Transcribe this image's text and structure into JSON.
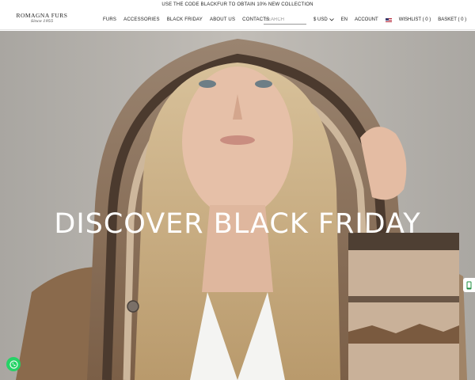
{
  "announcement": "USE THE CODE BLACKFUR TO OBTAIN 10% NEW COLLECTION",
  "logo": {
    "brand": "ROMAGNA FURS",
    "since": "Since 1955"
  },
  "nav": [
    "FURS",
    "ACCESSORIES",
    "BLACK FRIDAY",
    "ABOUT US",
    "CONTACTS"
  ],
  "search": {
    "placeholder": "SEARCH",
    "value": ""
  },
  "currency": "$ USD",
  "language": "EN",
  "account": "ACCOUNT",
  "wishlist": "WISHLIST ( 0 )",
  "basket": "BASKET ( 0 )",
  "hero": {
    "title": "DISCOVER BLACK FRIDAY"
  },
  "icons": {
    "flag": "us-flag-icon",
    "currency_dropdown": "chevron-down-icon",
    "whatsapp": "whatsapp-icon",
    "side_tab": "phone-icon"
  },
  "colors": {
    "whatsapp": "#25d366",
    "hero_text": "#ffffff"
  }
}
